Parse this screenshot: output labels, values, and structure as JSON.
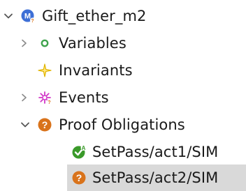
{
  "tree": {
    "root": {
      "label": "Gift_ether_m2",
      "icon": "machine-m-icon",
      "expanded": true
    },
    "children": [
      {
        "label": "Variables",
        "icon": "variable-circle-icon",
        "expandable": true,
        "expanded": false
      },
      {
        "label": "Invariants",
        "icon": "invariant-star-icon",
        "expandable": false
      },
      {
        "label": "Events",
        "icon": "event-burst-icon",
        "expandable": true,
        "expanded": false
      },
      {
        "label": "Proof Obligations",
        "icon": "question-mark-icon",
        "expandable": true,
        "expanded": true,
        "children": [
          {
            "label": "SetPass/act1/SIM",
            "icon": "proved-check-icon",
            "status": "proved"
          },
          {
            "label": "SetPass/act2/SIM",
            "icon": "unproved-question-icon",
            "status": "unproved",
            "selected": true
          }
        ]
      }
    ]
  },
  "colors": {
    "machine_blue": "#3d6fd6",
    "variable_green": "#3fa34d",
    "invariant_gold": "#e0b400",
    "event_magenta": "#d238c8",
    "po_orange": "#d9731b",
    "check_green": "#3a9a2a",
    "selection": "#d9d9d9"
  }
}
